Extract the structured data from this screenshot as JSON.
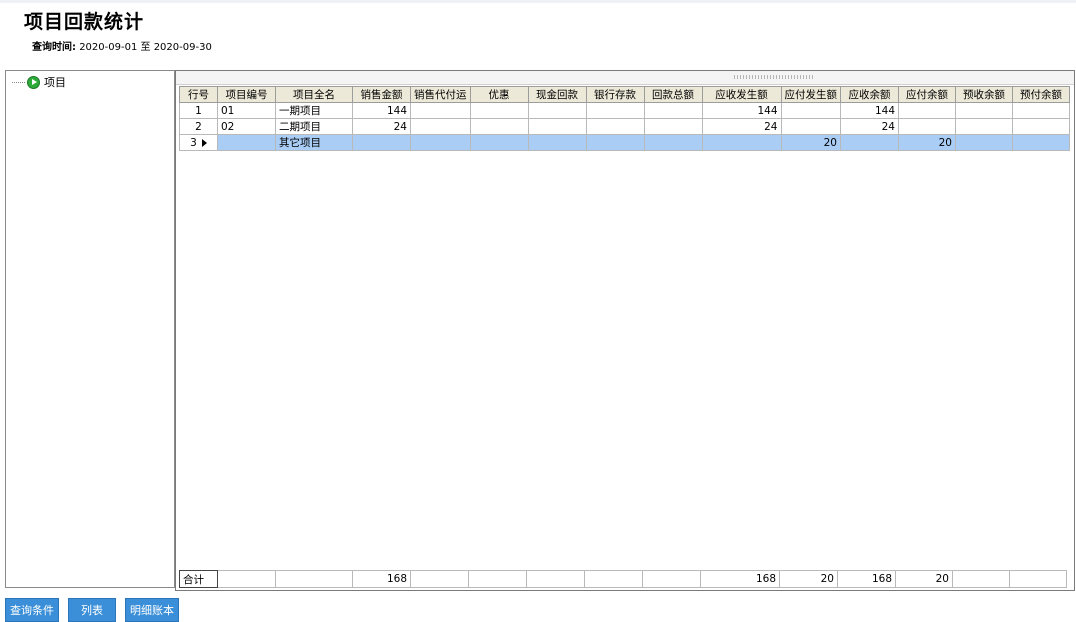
{
  "page": {
    "title": "项目回款统计",
    "query_label": "查询时间:",
    "date_from": "2020-09-01",
    "date_sep": "至",
    "date_to": "2020-09-30"
  },
  "tree": {
    "root_label": "项目"
  },
  "grid": {
    "columns": [
      "行号",
      "项目编号",
      "项目全名",
      "销售金额",
      "销售代付运",
      "优惠",
      "现金回款",
      "银行存款",
      "回款总额",
      "应收发生额",
      "应付发生额",
      "应收余额",
      "应付余额",
      "预收余额",
      "预付余额"
    ],
    "rows": [
      {
        "no": "1",
        "code": "01",
        "name": "一期项目",
        "sales": "144",
        "freight": "",
        "discount": "",
        "cash": "",
        "bank": "",
        "total_ret": "",
        "ar_incurred": "144",
        "ap_incurred": "",
        "ar_balance": "144",
        "ap_balance": "",
        "prepay_recv": "",
        "prepay_pay": ""
      },
      {
        "no": "2",
        "code": "02",
        "name": "二期项目",
        "sales": "24",
        "freight": "",
        "discount": "",
        "cash": "",
        "bank": "",
        "total_ret": "",
        "ar_incurred": "24",
        "ap_incurred": "",
        "ar_balance": "24",
        "ap_balance": "",
        "prepay_recv": "",
        "prepay_pay": ""
      },
      {
        "no": "3",
        "code": "",
        "name": "其它项目",
        "sales": "",
        "freight": "",
        "discount": "",
        "cash": "",
        "bank": "",
        "total_ret": "",
        "ar_incurred": "",
        "ap_incurred": "20",
        "ar_balance": "",
        "ap_balance": "20",
        "prepay_recv": "",
        "prepay_pay": ""
      }
    ],
    "totals": {
      "label": "合计",
      "sales": "168",
      "ar_incurred": "168",
      "ap_incurred": "20",
      "ar_balance": "168",
      "ap_balance": "20"
    }
  },
  "buttons": {
    "query": "查询条件",
    "list": "列表",
    "detail": "明细账本"
  }
}
